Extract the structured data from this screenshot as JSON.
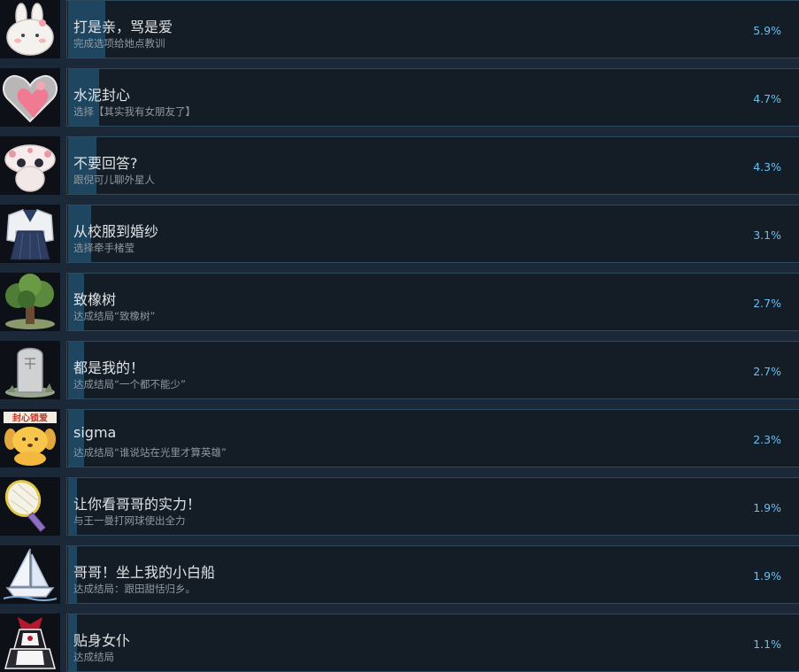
{
  "achievements": [
    {
      "icon": "bunny-icon",
      "title": "打是亲，骂是爱",
      "desc": "完成选项给她点教训",
      "percent_label": "5.9%",
      "percent": 5.9
    },
    {
      "icon": "heart-icon",
      "title": "水泥封心",
      "desc": "选择【其实我有女朋友了】",
      "percent_label": "4.7%",
      "percent": 4.7
    },
    {
      "icon": "alien-creature-icon",
      "title": "不要回答?",
      "desc": "跟倪可儿聊外星人",
      "percent_label": "4.3%",
      "percent": 4.3
    },
    {
      "icon": "school-uniform-icon",
      "title": "从校服到婚纱",
      "desc": "选择牵手楮莹",
      "percent_label": "3.1%",
      "percent": 3.1
    },
    {
      "icon": "oak-tree-icon",
      "title": "致橡树",
      "desc": "达成结局“致橡树”",
      "percent_label": "2.7%",
      "percent": 2.7
    },
    {
      "icon": "tombstone-icon",
      "title": "都是我的！",
      "desc": "达成结局“一个都不能少”",
      "percent_label": "2.7%",
      "percent": 2.7
    },
    {
      "icon": "puppy-sign-icon",
      "icon_sign_text": "封心锁爱",
      "title": "sigma",
      "desc": "达成结局“谁说站在光里才算英雄”",
      "percent_label": "2.3%",
      "percent": 2.3
    },
    {
      "icon": "tennis-racket-icon",
      "title": "让你看哥哥的实力！",
      "desc": "与王一曼打网球使出全力",
      "percent_label": "1.9%",
      "percent": 1.9
    },
    {
      "icon": "sailboat-icon",
      "title": "哥哥！坐上我的小白船",
      "desc": "达成结局：跟田甜恬归乡。",
      "percent_label": "1.9%",
      "percent": 1.9
    },
    {
      "icon": "maid-outfit-icon",
      "title": "贴身女仆",
      "desc": "达成结局",
      "percent_label": "1.1%",
      "percent": 1.1
    }
  ]
}
